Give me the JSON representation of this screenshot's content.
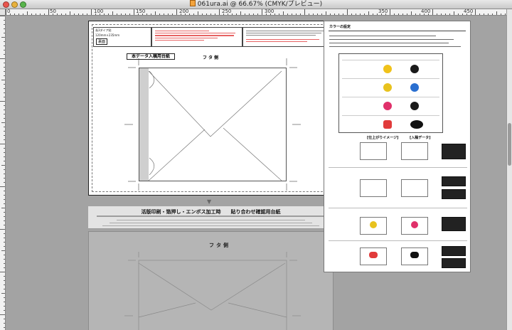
{
  "window": {
    "title": "061ura.ai @ 66.67% (CMYK/プレビュー)"
  },
  "ruler": {
    "h_labels": [
      "0",
      "50",
      "100",
      "150",
      "200",
      "250",
      "300",
      "350",
      "400",
      "450"
    ],
    "v_labels": [
      "",
      "",
      "",
      ""
    ]
  },
  "artboard1": {
    "box_left_line1": "長3ダイア貼",
    "box_left_line2": "120mm×235mm",
    "box_left_tag": "裏面",
    "label_box": "本データ入稿用台紙",
    "futa": "フタ側"
  },
  "artboard2": {
    "title": "活版印刷・箔押し・エンボス加工時　　貼り合わせ確認用台紙",
    "futa": "フタ側"
  },
  "artboard3": {
    "title": "カラーの設定",
    "panel_header_left": "[仕上がりイメージ]",
    "panel_header_right": "[入稿データ]"
  },
  "colors": {
    "accent_red": "#e13b3b",
    "swatch_yellow": "#f0c21a",
    "swatch_magenta": "#e0306a",
    "swatch_blue": "#2a6fd0"
  }
}
